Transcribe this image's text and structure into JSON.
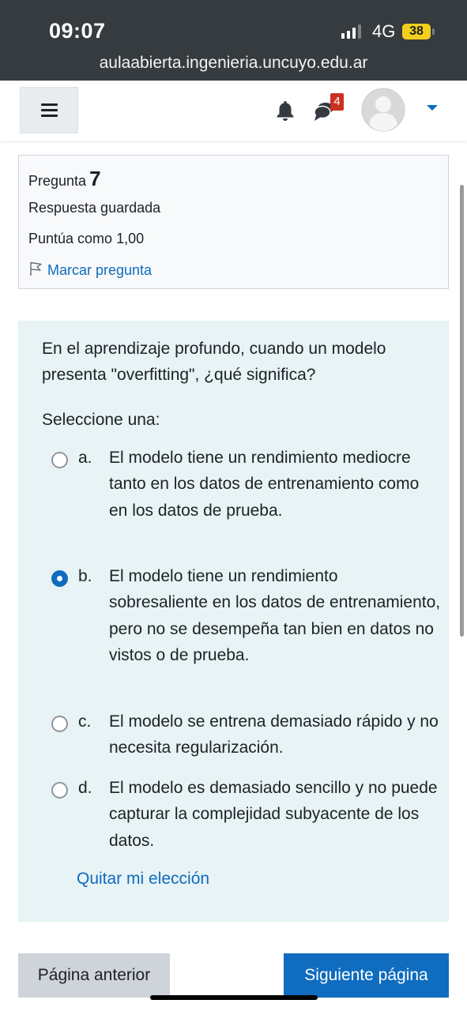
{
  "status_bar": {
    "time": "09:07",
    "network": "4G",
    "battery": "38",
    "battery_color": "#f2cf1d"
  },
  "browser": {
    "url": "aulaabierta.ingenieria.uncuyo.edu.ar"
  },
  "navbar": {
    "menu_icon": "hamburger-icon",
    "notification_icon": "bell-icon",
    "messages_icon": "chat-bubbles-icon",
    "messages_badge": "4",
    "avatar_icon": "user-avatar-icon",
    "dropdown_icon": "caret-down-icon"
  },
  "question_info": {
    "label": "Pregunta",
    "number": "7",
    "state": "Respuesta guardada",
    "grade": "Puntúa como 1,00",
    "flag_label": "Marcar pregunta"
  },
  "question": {
    "text": "En el aprendizaje profundo, cuando un modelo presenta \"overfitting\", ¿qué significa?",
    "prompt": "Seleccione una:",
    "options": [
      {
        "letter": "a.",
        "text": "El modelo tiene un rendimiento mediocre tanto en los datos de entrenamiento como en los datos de prueba.",
        "selected": false
      },
      {
        "letter": "b.",
        "text": "El modelo tiene un rendimiento sobresaliente en los datos de entrenamiento, pero no se desempeña tan bien en datos no vistos o de prueba.",
        "selected": true
      },
      {
        "letter": "c.",
        "text": "El modelo se entrena demasiado rápido y no necesita regularización.",
        "selected": false
      },
      {
        "letter": "d.",
        "text": "El modelo es demasiado sencillo y no puede capturar la complejidad subyacente de los datos.",
        "selected": false
      }
    ],
    "clear_label": "Quitar mi elección"
  },
  "navigation": {
    "prev_label": "Página anterior",
    "next_label": "Siguiente página"
  },
  "colors": {
    "primary": "#0f6cbf",
    "question_bg": "#e7f3f5",
    "badge": "#ca3120"
  }
}
